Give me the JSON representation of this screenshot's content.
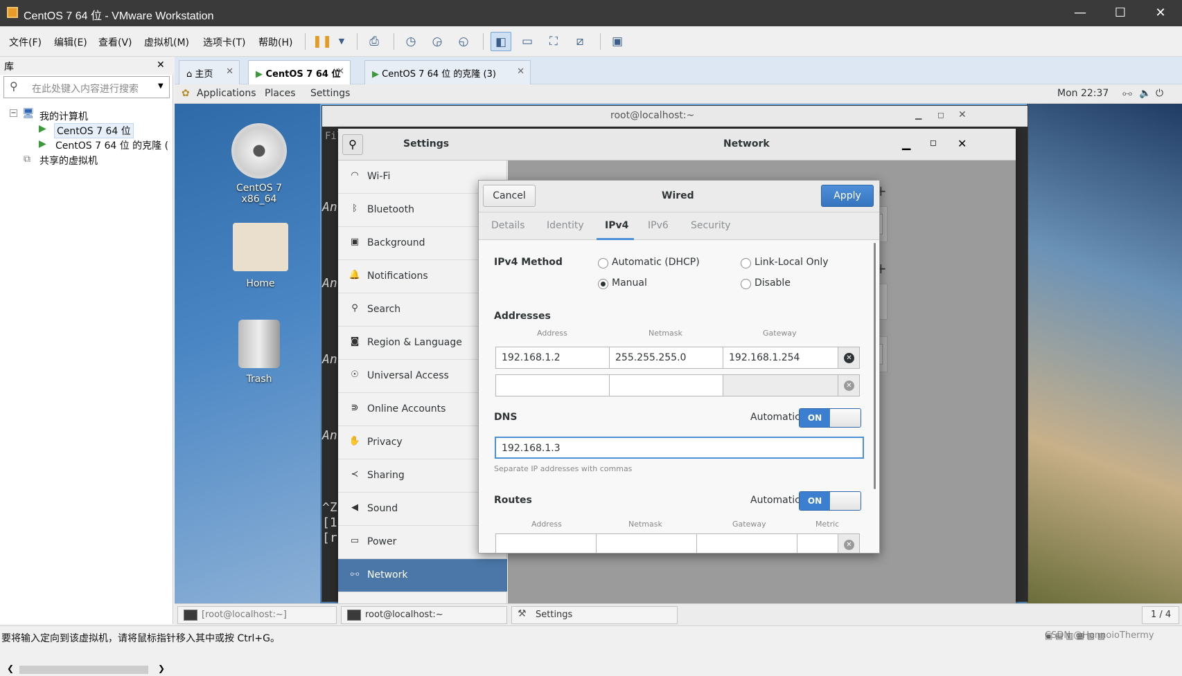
{
  "window": {
    "title": "CentOS 7 64 位 - VMware Workstation",
    "min": "—",
    "max": "☐",
    "close": "✕"
  },
  "menus": [
    "文件(F)",
    "编辑(E)",
    "查看(V)",
    "虚拟机(M)",
    "选项卡(T)",
    "帮助(H)"
  ],
  "library": {
    "title": "库",
    "close": "✕",
    "search_placeholder": "在此处键入内容进行搜索",
    "tree": {
      "root": "我的计算机",
      "children": [
        "CentOS 7 64 位",
        "CentOS 7 64 位 的克隆 ("
      ],
      "shared": "共享的虚拟机"
    }
  },
  "vm_tabs": [
    {
      "label": "主页"
    },
    {
      "label": "CentOS 7 64 位"
    },
    {
      "label": "CentOS 7 64 位 的克隆 (3)"
    }
  ],
  "gnome": {
    "applications": "Applications",
    "places": "Places",
    "settings": "Settings",
    "clock": "Mon 22:37"
  },
  "desktop": {
    "disc": "CentOS 7 x86_64",
    "home": "Home",
    "trash": "Trash"
  },
  "terminal": {
    "title": "root@localhost:~",
    "lines": [
      "An",
      "An",
      "An",
      "An",
      "^Z",
      "[1",
      "[r"
    ],
    "fil": "Fil"
  },
  "settings": {
    "title": "Settings",
    "pane_title": "Network",
    "items": [
      {
        "label": "Wi-Fi",
        "icon": "wifi-icon"
      },
      {
        "label": "Bluetooth",
        "icon": "bluetooth-icon"
      },
      {
        "label": "Background",
        "icon": "background-icon"
      },
      {
        "label": "Notifications",
        "icon": "bell-icon"
      },
      {
        "label": "Search",
        "icon": "search-icon"
      },
      {
        "label": "Region & Language",
        "icon": "camera-icon"
      },
      {
        "label": "Universal Access",
        "icon": "accessibility-icon"
      },
      {
        "label": "Online Accounts",
        "icon": "accounts-icon"
      },
      {
        "label": "Privacy",
        "icon": "hand-icon"
      },
      {
        "label": "Sharing",
        "icon": "share-icon"
      },
      {
        "label": "Sound",
        "icon": "speaker-icon"
      },
      {
        "label": "Power",
        "icon": "power-icon"
      },
      {
        "label": "Network",
        "icon": "network-icon"
      }
    ],
    "plus": "+"
  },
  "dialog": {
    "title": "Wired",
    "cancel": "Cancel",
    "apply": "Apply",
    "tabs": [
      "Details",
      "Identity",
      "IPv4",
      "IPv6",
      "Security"
    ],
    "method_label": "IPv4 Method",
    "methods": [
      "Automatic (DHCP)",
      "Link-Local Only",
      "Manual",
      "Disable"
    ],
    "addresses_label": "Addresses",
    "cols": [
      "Address",
      "Netmask",
      "Gateway"
    ],
    "row1": {
      "address": "192.168.1.2",
      "netmask": "255.255.255.0",
      "gateway": "192.168.1.254"
    },
    "dns_label": "DNS",
    "automatic": "Automatic",
    "on": "ON",
    "dns_value": "192.168.1.3",
    "dns_hint": "Separate IP addresses with commas",
    "routes_label": "Routes",
    "route_cols": [
      "Address",
      "Netmask",
      "Gateway",
      "Metric"
    ]
  },
  "taskbar": {
    "items": [
      "[root@localhost:~]",
      "root@localhost:~",
      "Settings"
    ],
    "pager": "1 / 4"
  },
  "status": {
    "text": "要将输入定向到该虚拟机，请将鼠标指针移入其中或按 Ctrl+G。",
    "watermark": "CSDN @HonnoioThermy"
  },
  "colors": {
    "accent": "#3575c0",
    "selected": "#4a77a8"
  }
}
